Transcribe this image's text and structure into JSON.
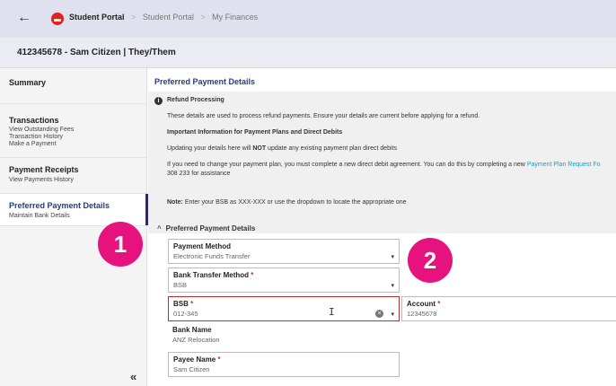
{
  "topbar": {
    "back_icon": "←",
    "brand": "Student Portal",
    "crumbs": [
      "Student Portal",
      "My Finances"
    ],
    "separator": ">"
  },
  "user": {
    "header": "412345678 - Sam Citizen | They/Them"
  },
  "sidebar": {
    "items": [
      {
        "title": "Summary",
        "subs": []
      },
      {
        "title": "Transactions",
        "subs": [
          "View Outstanding Fees",
          "Transaction History",
          "Make a Payment"
        ]
      },
      {
        "title": "Payment Receipts",
        "subs": [
          "View Payments History"
        ]
      },
      {
        "title": "Preferred Payment Details",
        "subs": [
          "Maintain Bank Details"
        ]
      }
    ],
    "collapse_icon": "«"
  },
  "main": {
    "title": "Preferred Payment Details",
    "info": {
      "icon": "i",
      "heading": "Refund Processing",
      "line1": "These details are used to process refund payments. Ensure your details are current before applying for a refund.",
      "heading2": "Important Information for Payment Plans and Direct Debits",
      "line2_pre": "Updating your details here will ",
      "line2_bold": "NOT",
      "line2_post": " update any existing payment plan direct debits",
      "line3_pre": "If you need to change your payment plan, you must complete a new direct debit agreement. You can do this by completing a new ",
      "line3_link": "Payment Plan Request Fo",
      "line4": "308 233 for assistance",
      "note_label": "Note:",
      "note_text": " Enter your BSB as XXX-XXX or use the dropdown to locate the appropriate one"
    },
    "section": {
      "chevron": "^",
      "title": "Preferred Payment Details"
    },
    "fields": {
      "payment_method": {
        "label": "Payment Method",
        "value": "Electronic Funds Transfer"
      },
      "bank_transfer_method": {
        "label": "Bank Transfer Method",
        "required": "*",
        "value": "BSB"
      },
      "bsb": {
        "label": "BSB",
        "required": "*",
        "value": "012-345",
        "clear_icon": "×"
      },
      "account": {
        "label": "Account",
        "required": "*",
        "value": "12345678"
      },
      "bank_name": {
        "label": "Bank Name",
        "value": "ANZ Relocation"
      },
      "payee_name": {
        "label": "Payee Name",
        "required": "*",
        "value": "Sam Citizen"
      }
    },
    "dropdown_icon": "▾"
  },
  "markers": [
    "1",
    "2"
  ],
  "colors": {
    "marker": "#e6137e",
    "accent": "#1c3e8a",
    "link": "#1a9fc9",
    "error": "#b53030"
  }
}
